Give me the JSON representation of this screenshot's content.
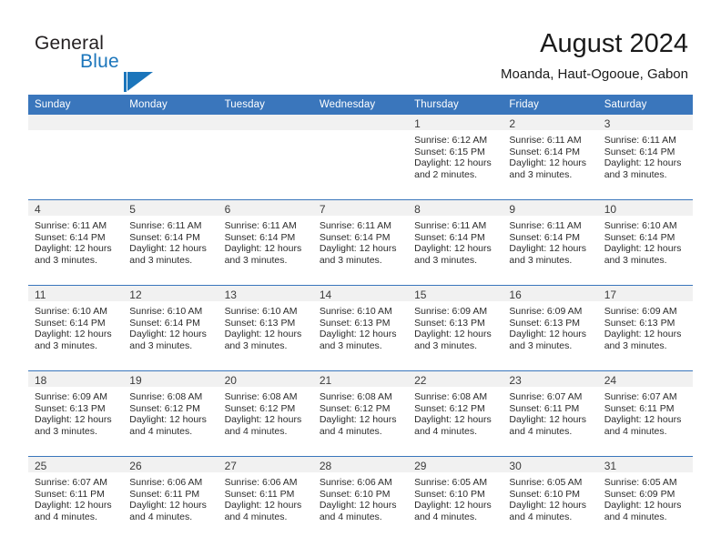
{
  "brand": {
    "word_one": "General",
    "word_two": "Blue",
    "flag_icon": "flag-triangle-icon",
    "accent_color": "#1b75bb"
  },
  "header": {
    "title": "August 2024",
    "subtitle": "Moanda, Haut-Ogooue, Gabon",
    "header_bg_color": "#3a76bc",
    "daynum_band_color": "#f1f1f1"
  },
  "weekday_headers": [
    "Sunday",
    "Monday",
    "Tuesday",
    "Wednesday",
    "Thursday",
    "Friday",
    "Saturday"
  ],
  "labels": {
    "sunrise_prefix": "Sunrise:",
    "sunset_prefix": "Sunset:",
    "daylight_prefix": "Daylight:"
  },
  "weeks": [
    [
      {
        "day": "",
        "empty": true
      },
      {
        "day": "",
        "empty": true
      },
      {
        "day": "",
        "empty": true
      },
      {
        "day": "",
        "empty": true
      },
      {
        "day": "1",
        "sunrise": "Sunrise: 6:12 AM",
        "sunset": "Sunset: 6:15 PM",
        "daylight_line1": "Daylight: 12 hours",
        "daylight_line2": "and 2 minutes."
      },
      {
        "day": "2",
        "sunrise": "Sunrise: 6:11 AM",
        "sunset": "Sunset: 6:14 PM",
        "daylight_line1": "Daylight: 12 hours",
        "daylight_line2": "and 3 minutes."
      },
      {
        "day": "3",
        "sunrise": "Sunrise: 6:11 AM",
        "sunset": "Sunset: 6:14 PM",
        "daylight_line1": "Daylight: 12 hours",
        "daylight_line2": "and 3 minutes."
      }
    ],
    [
      {
        "day": "4",
        "sunrise": "Sunrise: 6:11 AM",
        "sunset": "Sunset: 6:14 PM",
        "daylight_line1": "Daylight: 12 hours",
        "daylight_line2": "and 3 minutes."
      },
      {
        "day": "5",
        "sunrise": "Sunrise: 6:11 AM",
        "sunset": "Sunset: 6:14 PM",
        "daylight_line1": "Daylight: 12 hours",
        "daylight_line2": "and 3 minutes."
      },
      {
        "day": "6",
        "sunrise": "Sunrise: 6:11 AM",
        "sunset": "Sunset: 6:14 PM",
        "daylight_line1": "Daylight: 12 hours",
        "daylight_line2": "and 3 minutes."
      },
      {
        "day": "7",
        "sunrise": "Sunrise: 6:11 AM",
        "sunset": "Sunset: 6:14 PM",
        "daylight_line1": "Daylight: 12 hours",
        "daylight_line2": "and 3 minutes."
      },
      {
        "day": "8",
        "sunrise": "Sunrise: 6:11 AM",
        "sunset": "Sunset: 6:14 PM",
        "daylight_line1": "Daylight: 12 hours",
        "daylight_line2": "and 3 minutes."
      },
      {
        "day": "9",
        "sunrise": "Sunrise: 6:11 AM",
        "sunset": "Sunset: 6:14 PM",
        "daylight_line1": "Daylight: 12 hours",
        "daylight_line2": "and 3 minutes."
      },
      {
        "day": "10",
        "sunrise": "Sunrise: 6:10 AM",
        "sunset": "Sunset: 6:14 PM",
        "daylight_line1": "Daylight: 12 hours",
        "daylight_line2": "and 3 minutes."
      }
    ],
    [
      {
        "day": "11",
        "sunrise": "Sunrise: 6:10 AM",
        "sunset": "Sunset: 6:14 PM",
        "daylight_line1": "Daylight: 12 hours",
        "daylight_line2": "and 3 minutes."
      },
      {
        "day": "12",
        "sunrise": "Sunrise: 6:10 AM",
        "sunset": "Sunset: 6:14 PM",
        "daylight_line1": "Daylight: 12 hours",
        "daylight_line2": "and 3 minutes."
      },
      {
        "day": "13",
        "sunrise": "Sunrise: 6:10 AM",
        "sunset": "Sunset: 6:13 PM",
        "daylight_line1": "Daylight: 12 hours",
        "daylight_line2": "and 3 minutes."
      },
      {
        "day": "14",
        "sunrise": "Sunrise: 6:10 AM",
        "sunset": "Sunset: 6:13 PM",
        "daylight_line1": "Daylight: 12 hours",
        "daylight_line2": "and 3 minutes."
      },
      {
        "day": "15",
        "sunrise": "Sunrise: 6:09 AM",
        "sunset": "Sunset: 6:13 PM",
        "daylight_line1": "Daylight: 12 hours",
        "daylight_line2": "and 3 minutes."
      },
      {
        "day": "16",
        "sunrise": "Sunrise: 6:09 AM",
        "sunset": "Sunset: 6:13 PM",
        "daylight_line1": "Daylight: 12 hours",
        "daylight_line2": "and 3 minutes."
      },
      {
        "day": "17",
        "sunrise": "Sunrise: 6:09 AM",
        "sunset": "Sunset: 6:13 PM",
        "daylight_line1": "Daylight: 12 hours",
        "daylight_line2": "and 3 minutes."
      }
    ],
    [
      {
        "day": "18",
        "sunrise": "Sunrise: 6:09 AM",
        "sunset": "Sunset: 6:13 PM",
        "daylight_line1": "Daylight: 12 hours",
        "daylight_line2": "and 3 minutes."
      },
      {
        "day": "19",
        "sunrise": "Sunrise: 6:08 AM",
        "sunset": "Sunset: 6:12 PM",
        "daylight_line1": "Daylight: 12 hours",
        "daylight_line2": "and 4 minutes."
      },
      {
        "day": "20",
        "sunrise": "Sunrise: 6:08 AM",
        "sunset": "Sunset: 6:12 PM",
        "daylight_line1": "Daylight: 12 hours",
        "daylight_line2": "and 4 minutes."
      },
      {
        "day": "21",
        "sunrise": "Sunrise: 6:08 AM",
        "sunset": "Sunset: 6:12 PM",
        "daylight_line1": "Daylight: 12 hours",
        "daylight_line2": "and 4 minutes."
      },
      {
        "day": "22",
        "sunrise": "Sunrise: 6:08 AM",
        "sunset": "Sunset: 6:12 PM",
        "daylight_line1": "Daylight: 12 hours",
        "daylight_line2": "and 4 minutes."
      },
      {
        "day": "23",
        "sunrise": "Sunrise: 6:07 AM",
        "sunset": "Sunset: 6:11 PM",
        "daylight_line1": "Daylight: 12 hours",
        "daylight_line2": "and 4 minutes."
      },
      {
        "day": "24",
        "sunrise": "Sunrise: 6:07 AM",
        "sunset": "Sunset: 6:11 PM",
        "daylight_line1": "Daylight: 12 hours",
        "daylight_line2": "and 4 minutes."
      }
    ],
    [
      {
        "day": "25",
        "sunrise": "Sunrise: 6:07 AM",
        "sunset": "Sunset: 6:11 PM",
        "daylight_line1": "Daylight: 12 hours",
        "daylight_line2": "and 4 minutes."
      },
      {
        "day": "26",
        "sunrise": "Sunrise: 6:06 AM",
        "sunset": "Sunset: 6:11 PM",
        "daylight_line1": "Daylight: 12 hours",
        "daylight_line2": "and 4 minutes."
      },
      {
        "day": "27",
        "sunrise": "Sunrise: 6:06 AM",
        "sunset": "Sunset: 6:11 PM",
        "daylight_line1": "Daylight: 12 hours",
        "daylight_line2": "and 4 minutes."
      },
      {
        "day": "28",
        "sunrise": "Sunrise: 6:06 AM",
        "sunset": "Sunset: 6:10 PM",
        "daylight_line1": "Daylight: 12 hours",
        "daylight_line2": "and 4 minutes."
      },
      {
        "day": "29",
        "sunrise": "Sunrise: 6:05 AM",
        "sunset": "Sunset: 6:10 PM",
        "daylight_line1": "Daylight: 12 hours",
        "daylight_line2": "and 4 minutes."
      },
      {
        "day": "30",
        "sunrise": "Sunrise: 6:05 AM",
        "sunset": "Sunset: 6:10 PM",
        "daylight_line1": "Daylight: 12 hours",
        "daylight_line2": "and 4 minutes."
      },
      {
        "day": "31",
        "sunrise": "Sunrise: 6:05 AM",
        "sunset": "Sunset: 6:09 PM",
        "daylight_line1": "Daylight: 12 hours",
        "daylight_line2": "and 4 minutes."
      }
    ]
  ]
}
